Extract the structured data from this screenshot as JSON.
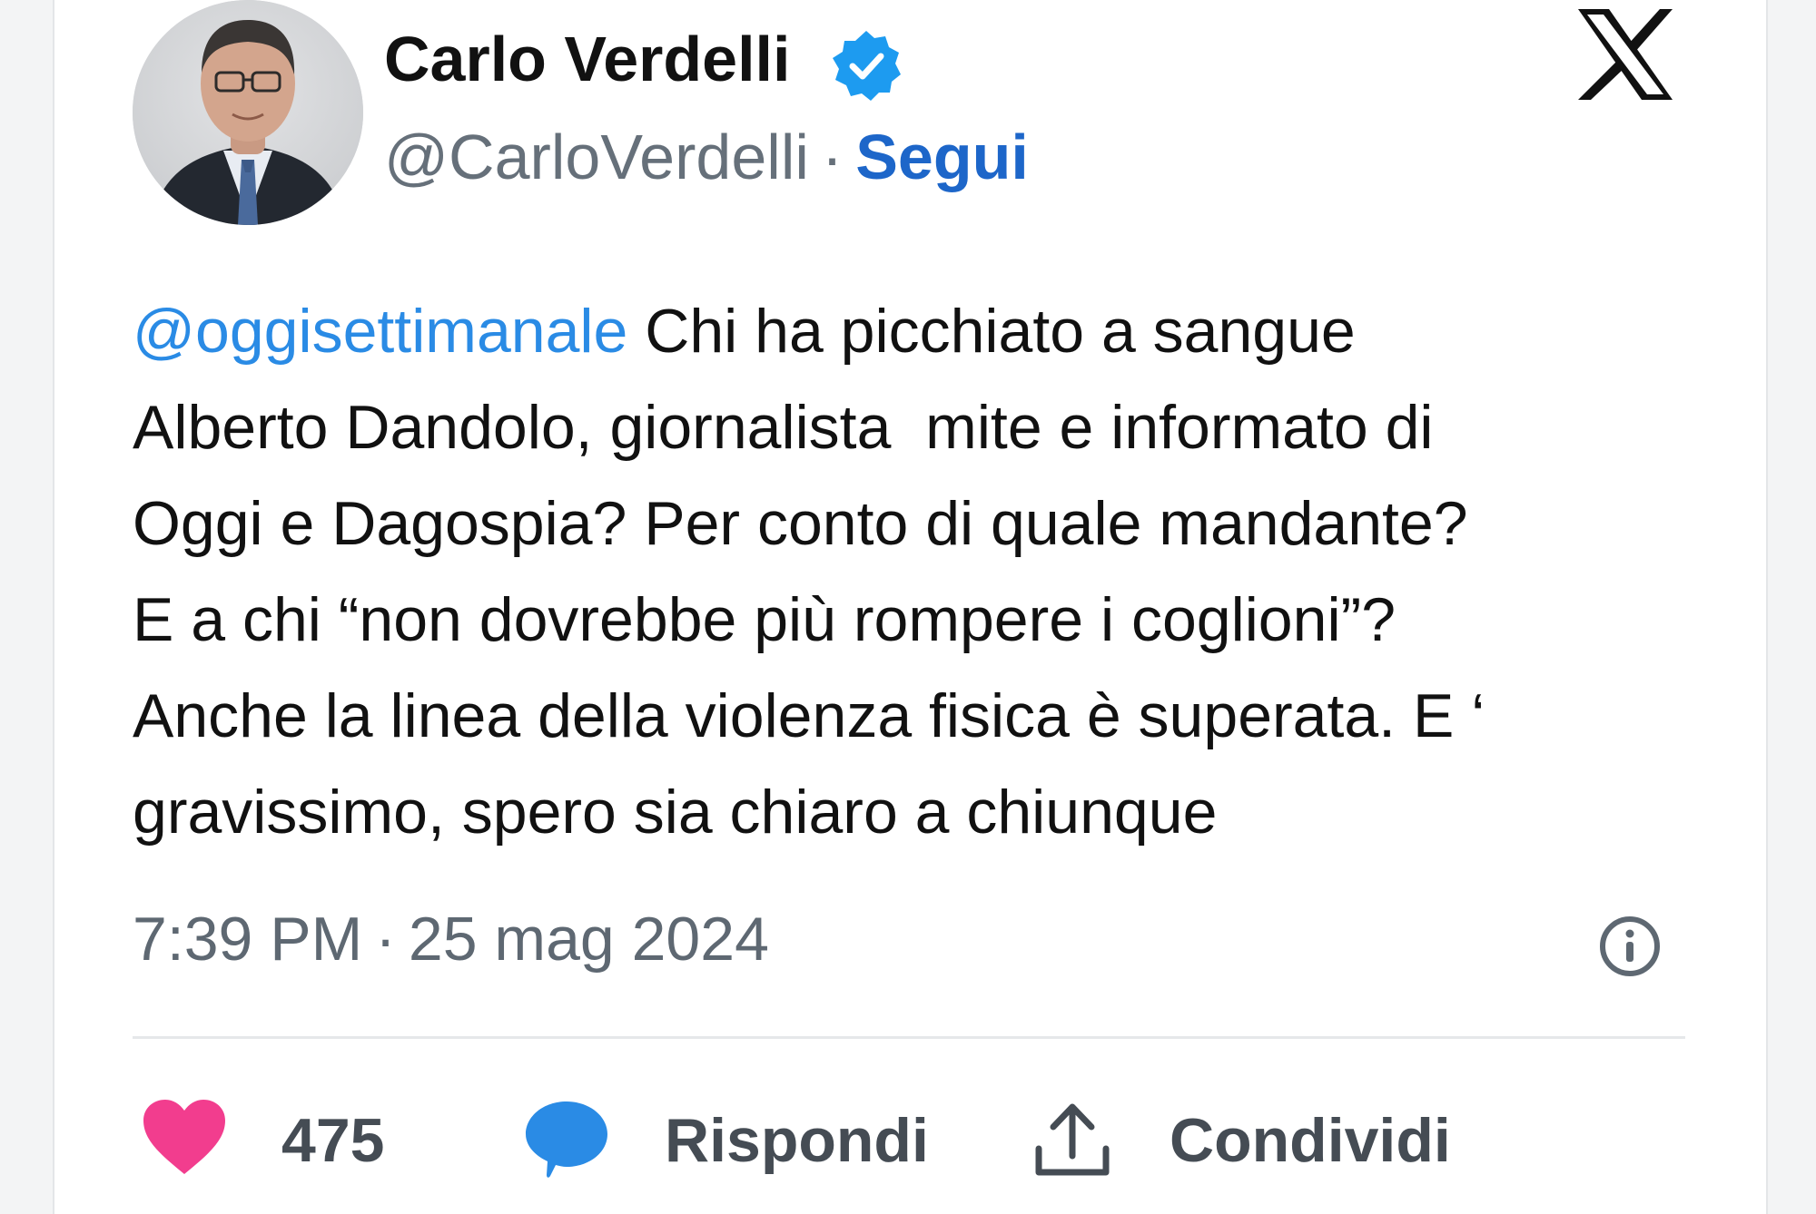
{
  "author": {
    "display_name": "Carlo Verdelli",
    "handle": "@CarloVerdelli",
    "separator": "·",
    "follow_label": "Segui",
    "verified_icon": "verified-badge-icon",
    "avatar_icon": "profile-photo"
  },
  "brand": {
    "logo_icon": "x-logo-icon"
  },
  "tweet": {
    "mention": "@oggisettimanale",
    "text": " Chi ha picchiato a sangue\nAlberto Dandolo, giornalista  mite e informato di\nOggi e Dagospia? Per conto di quale mandante?\nE a chi “non dovrebbe più rompere i coglioni”?\nAnche la linea della violenza fisica è superata. E ‘\ngravissimo, spero sia chiaro a chiunque"
  },
  "meta": {
    "time": "7:39 PM",
    "separator": "·",
    "date": "25 mag 2024",
    "info_icon": "info-icon"
  },
  "actions": {
    "like_icon": "heart-icon",
    "like_count": "475",
    "reply_icon": "comment-bubble-icon",
    "reply_label": "Rispondi",
    "share_icon": "share-upload-icon",
    "share_label": "Condividi"
  },
  "colors": {
    "accent": "#1d66c9",
    "mention": "#2a8be5",
    "verified": "#1d9bf0",
    "like": "#f23d8e",
    "reply": "#2a8be5",
    "text": "#111111",
    "muted": "#5e6872"
  }
}
